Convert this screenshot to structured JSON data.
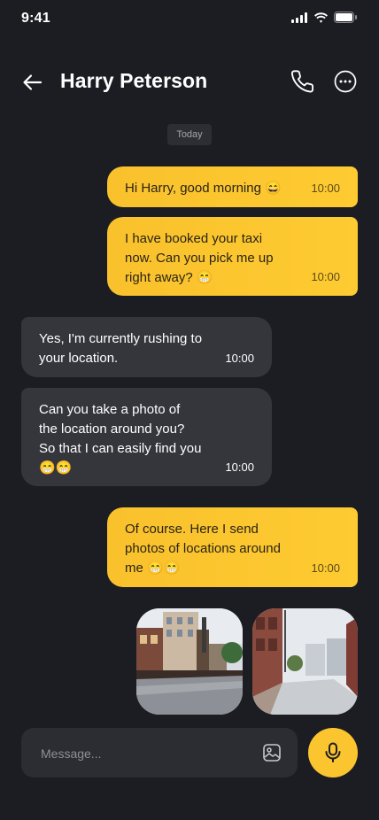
{
  "status_bar": {
    "time": "9:41"
  },
  "header": {
    "contact_name": "Harry Peterson"
  },
  "date_separator": "Today",
  "messages": [
    {
      "direction": "outgoing",
      "text": "Hi Harry, good morning 😄",
      "time": "10:00"
    },
    {
      "direction": "outgoing",
      "text": "I have booked your taxi\nnow. Can you pick me up\nright away? 😁",
      "time": "10:00"
    },
    {
      "direction": "incoming",
      "text": "Yes, I'm currently rushing to\nyour location.",
      "time": "10:00"
    },
    {
      "direction": "incoming",
      "text": "Can you take a photo of\nthe location around you?\nSo that I can easily find you\n😁😁",
      "time": "10:00"
    },
    {
      "direction": "outgoing",
      "text": "Of course. Here I send\nphotos of locations around\nme 😁😁",
      "time": "10:00"
    }
  ],
  "photos": [
    {
      "description": "street-photo"
    },
    {
      "description": "alley-photo"
    }
  ],
  "composer": {
    "placeholder": "Message..."
  },
  "colors": {
    "background": "#1c1d22",
    "outgoing_bubble": "#fbc52f",
    "incoming_bubble": "#35363c",
    "accent": "#fbc52f"
  }
}
